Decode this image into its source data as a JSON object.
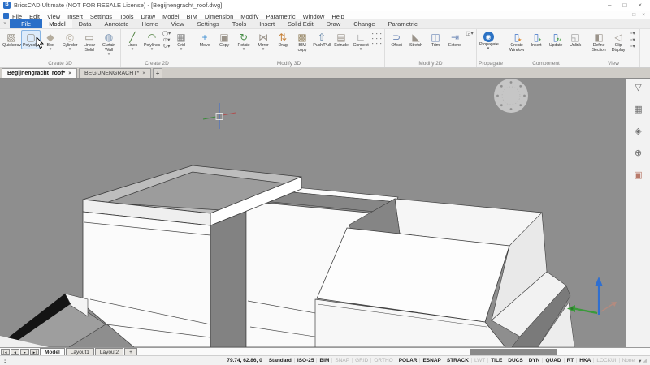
{
  "window": {
    "title": "BricsCAD Ultimate (NOT FOR RESALE License) - [Begijnengracht_roof.dwg]",
    "app_icon_letter": "B",
    "controls": {
      "minimize": "–",
      "maximize": "□",
      "close": "×"
    },
    "doc_controls": {
      "minimize": "–",
      "restore": "□",
      "close": "×"
    }
  },
  "menu_bar": {
    "items": [
      "File",
      "Edit",
      "View",
      "Insert",
      "Settings",
      "Tools",
      "Draw",
      "Model",
      "BIM",
      "Dimension",
      "Modify",
      "Parametric",
      "Window",
      "Help"
    ]
  },
  "ribbon": {
    "close_glyph": "×",
    "tabs": [
      {
        "label": "File",
        "style": "file"
      },
      {
        "label": "Model",
        "style": "active"
      },
      {
        "label": "Data"
      },
      {
        "label": "Annotate"
      },
      {
        "label": "Home"
      },
      {
        "label": "View"
      },
      {
        "label": "Settings"
      },
      {
        "label": "Tools"
      },
      {
        "label": "Insert"
      },
      {
        "label": "Solid Edit"
      },
      {
        "label": "Draw"
      },
      {
        "label": "Change"
      },
      {
        "label": "Parametric"
      }
    ],
    "groups": [
      {
        "name": "Create 3D",
        "items": [
          {
            "label": "Quickdraw",
            "icon": "quickdraw-icon",
            "glyph": "▧",
            "color": "#8d8679"
          },
          {
            "label": "Polysolid",
            "icon": "polysolid-icon",
            "glyph": "▢",
            "color": "#8d8679",
            "hover": true
          },
          {
            "label": "Box",
            "icon": "box-icon",
            "glyph": "◆",
            "color": "#b5ad9e",
            "arrow": true
          },
          {
            "label": "Cylinder",
            "icon": "cylinder-icon",
            "glyph": "◎",
            "color": "#b5ad9e",
            "arrow": true
          },
          {
            "label": "Linear Solid",
            "icon": "linear-solid-icon",
            "glyph": "▭",
            "color": "#8d8679"
          },
          {
            "label": "Curtain Wall",
            "icon": "curtain-wall-icon",
            "glyph": "◍",
            "color": "#7d96b5",
            "arrow": true
          }
        ]
      },
      {
        "name": "Create 2D",
        "items": [
          {
            "label": "Lines",
            "icon": "lines-icon",
            "glyph": "╱",
            "color": "#4a7d3a",
            "arrow": true
          },
          {
            "label": "Polylines",
            "icon": "polylines-icon",
            "glyph": "◠",
            "color": "#4a7d3a",
            "arrow": true
          },
          {
            "icon": "circle-tools-cluster",
            "cluster": "col3",
            "glyphs": [
              "◯",
              "⊙",
              "↻"
            ]
          },
          {
            "label": "Grid",
            "icon": "grid-icon",
            "glyph": "▦",
            "color": "#8a8a8a",
            "arrow": true
          }
        ]
      },
      {
        "name": "Modify 3D",
        "items": [
          {
            "label": "Move",
            "icon": "move-icon",
            "glyph": "+",
            "color": "#3f8fd2"
          },
          {
            "label": "Copy",
            "icon": "copy-icon",
            "glyph": "▣",
            "color": "#9a938a"
          },
          {
            "label": "Rotate",
            "icon": "rotate-icon",
            "glyph": "↻",
            "color": "#4a8f4a",
            "arrow": true
          },
          {
            "label": "Mirror",
            "icon": "mirror-icon",
            "glyph": "⋈",
            "color": "#9a938a",
            "arrow": true
          },
          {
            "label": "Drag",
            "icon": "drag-icon",
            "glyph": "⇅",
            "color": "#c7823a"
          },
          {
            "label": "BIM copy",
            "icon": "bim-copy-icon",
            "glyph": "▩",
            "color": "#9a8a6a"
          },
          {
            "label": "Push/Pull",
            "icon": "push-pull-icon",
            "glyph": "⇧",
            "color": "#5a7da0"
          },
          {
            "label": "Extrude",
            "icon": "extrude-icon",
            "glyph": "▤",
            "color": "#9a938a"
          },
          {
            "label": "Connect",
            "icon": "connect-icon",
            "glyph": "∟",
            "color": "#8a8a8a",
            "arrow": true
          },
          {
            "icon": "modify3d-more-grid",
            "cluster": "grid9"
          }
        ]
      },
      {
        "name": "Modify 2D",
        "items": [
          {
            "label": "Offset",
            "icon": "offset-icon",
            "glyph": "⊃",
            "color": "#6a85b5"
          },
          {
            "label": "Stretch",
            "icon": "stretch-icon",
            "glyph": "◣",
            "color": "#9a938a"
          },
          {
            "label": "Trim",
            "icon": "trim-icon",
            "glyph": "◫",
            "color": "#6a85b5"
          },
          {
            "label": "Extend",
            "icon": "extend-icon",
            "glyph": "⇥",
            "color": "#6a85b5"
          },
          {
            "icon": "corner-tool-icon",
            "cluster": "col3",
            "glyphs": [
              "◲"
            ]
          }
        ]
      },
      {
        "name": "Propagate",
        "items": [
          {
            "label": "Propagate",
            "icon": "propagate-icon",
            "glyph": "◉",
            "color": "#2b72c4",
            "arrow": true,
            "round": true
          }
        ]
      },
      {
        "name": "Component",
        "items": [
          {
            "label": "Create Window",
            "icon": "create-window-icon",
            "glyph": "▯",
            "color": "#3a6fc4",
            "badge": "★",
            "badge_color": "#e0892a"
          },
          {
            "label": "Insert",
            "icon": "insert-component-icon",
            "glyph": "▯",
            "color": "#3a6fc4",
            "badge": "+",
            "badge_color": "#3a9a3a"
          },
          {
            "label": "Update",
            "icon": "update-component-icon",
            "glyph": "▯",
            "color": "#3a6fc4",
            "badge": "↻",
            "badge_color": "#3a9a3a"
          },
          {
            "label": "Unlink",
            "icon": "unlink-icon",
            "glyph": "◱",
            "color": "#9a9a9a"
          }
        ]
      },
      {
        "name": "View",
        "items": [
          {
            "label": "Define Section",
            "icon": "define-section-icon",
            "glyph": "◧",
            "color": "#9a938a"
          },
          {
            "label": "Clip Display",
            "icon": "clip-display-icon",
            "glyph": "◁",
            "color": "#9a938a"
          },
          {
            "icon": "view-toggles-cluster",
            "cluster": "col3",
            "glyphs": [
              "▫",
              "▫",
              "▫"
            ]
          }
        ]
      }
    ]
  },
  "doc_tabs": {
    "tabs": [
      {
        "label": "Begijnengracht_roof*",
        "active": true,
        "close": "×"
      },
      {
        "label": "BEGIJNENGRACHT*",
        "active": false,
        "close": "×"
      }
    ],
    "add": "+"
  },
  "viewport": {
    "background": "#8e8e8e",
    "lookfrom_widget": "lookfrom-navigation-sphere",
    "crosshair_colors": {
      "x_axis": "#b05050",
      "y_axis": "#3a8a3a",
      "z_axis": "#3a6ad0"
    },
    "ucs_colors": {
      "x_axis": "#c08a7a",
      "y_axis": "#3a9a3a",
      "z_axis": "#2f6fd0"
    }
  },
  "side_panel": {
    "icons": [
      {
        "name": "filter-icon",
        "glyph": "▽"
      },
      {
        "name": "table-icon",
        "glyph": "▦"
      },
      {
        "name": "layers-icon",
        "glyph": "◈"
      },
      {
        "name": "sphere-icon",
        "glyph": "⊕"
      },
      {
        "name": "materials-icon",
        "glyph": "▣",
        "color": "#b87a6a"
      }
    ]
  },
  "layout_bar": {
    "nav": [
      "|◄",
      "◄",
      "►",
      "►|"
    ],
    "tabs": [
      {
        "label": "Model",
        "active": true
      },
      {
        "label": "Layout1",
        "active": false
      },
      {
        "label": "Layout2",
        "active": false
      }
    ],
    "add": "+"
  },
  "status_bar": {
    "prompt": ":",
    "coords": "79.74, 62.86, 0",
    "fields": [
      {
        "label": "Standard",
        "active": true
      },
      {
        "label": "ISO-25",
        "active": true
      },
      {
        "label": "BIM",
        "active": true
      },
      {
        "label": "SNAP",
        "active": false
      },
      {
        "label": "GRID",
        "active": false
      },
      {
        "label": "ORTHO",
        "active": false
      },
      {
        "label": "POLAR",
        "active": true
      },
      {
        "label": "ESNAP",
        "active": true
      },
      {
        "label": "STRACK",
        "active": true
      },
      {
        "label": "LWT",
        "active": false
      },
      {
        "label": "TILE",
        "active": true
      },
      {
        "label": "DUCS",
        "active": true
      },
      {
        "label": "DYN",
        "active": true
      },
      {
        "label": "QUAD",
        "active": true
      },
      {
        "label": "RT",
        "active": true
      },
      {
        "label": "HKA",
        "active": true
      },
      {
        "label": "LOCKUI",
        "active": false
      },
      {
        "label": "None",
        "active": false
      }
    ],
    "dropdown": "▾"
  }
}
